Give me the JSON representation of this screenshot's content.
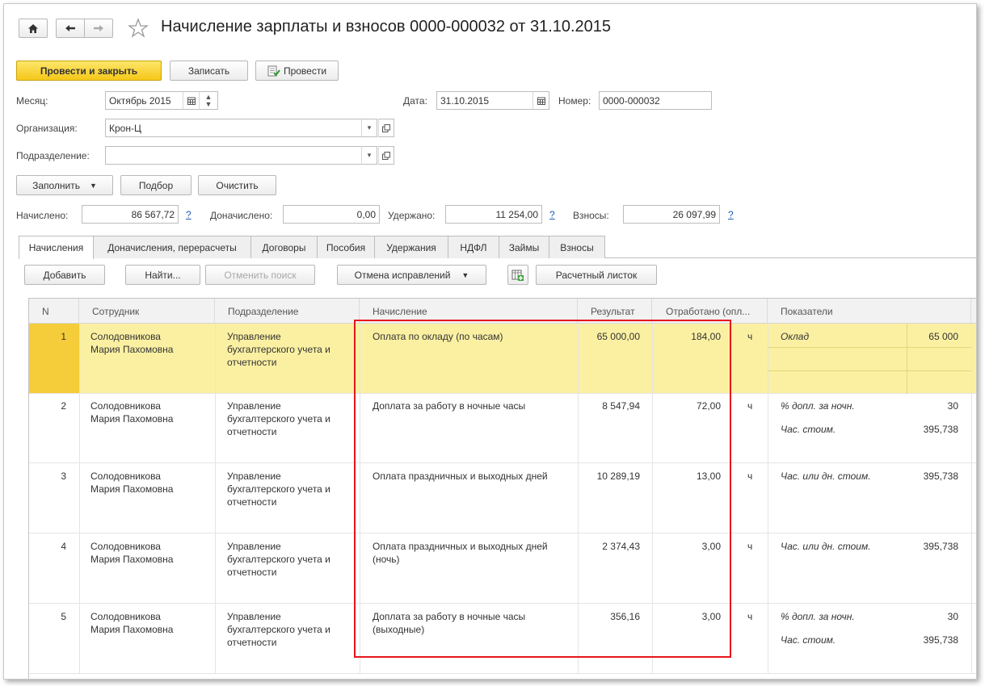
{
  "header": {
    "title": "Начисление зарплаты и взносов 0000-000032 от 31.10.2015",
    "home_icon": "home-icon",
    "back_icon": "arrow-left-icon",
    "forward_icon": "arrow-right-icon",
    "star_icon": "star-icon"
  },
  "toolbar": {
    "post_close_label": "Провести и закрыть",
    "save_label": "Записать",
    "post_label": "Провести"
  },
  "form": {
    "month_label": "Месяц:",
    "month_value": "Октябрь 2015",
    "date_label": "Дата:",
    "date_value": "31.10.2015",
    "number_label": "Номер:",
    "number_value": "0000-000032",
    "org_label": "Организация:",
    "org_value": "Крон-Ц",
    "dept_label": "Подразделение:",
    "dept_value": ""
  },
  "actions": {
    "fill_label": "Заполнить",
    "select_label": "Подбор",
    "clear_label": "Очистить"
  },
  "totals": {
    "accrued_label": "Начислено:",
    "accrued_value": "86 567,72",
    "additional_label": "Доначислено:",
    "additional_value": "0,00",
    "withheld_label": "Удержано:",
    "withheld_value": "11 254,00",
    "contrib_label": "Взносы:",
    "contrib_value": "26 097,99",
    "help_mark": "?"
  },
  "tabs": [
    {
      "label": "Начисления"
    },
    {
      "label": "Доначисления, перерасчеты"
    },
    {
      "label": "Договоры"
    },
    {
      "label": "Пособия"
    },
    {
      "label": "Удержания"
    },
    {
      "label": "НДФЛ"
    },
    {
      "label": "Займы"
    },
    {
      "label": "Взносы"
    }
  ],
  "table_toolbar": {
    "add_label": "Добавить",
    "find_label": "Найти...",
    "cancel_search_label": "Отменить поиск",
    "cancel_fix_label": "Отмена исправлений",
    "payslip_label": "Расчетный листок"
  },
  "columns": [
    "N",
    "Сотрудник",
    "Подразделение",
    "Начисление",
    "Результат",
    "Отработано (опл...",
    "Показатели"
  ],
  "rows": [
    {
      "n": "1",
      "emp1": "Солодовникова",
      "emp2": "Мария Пахомовна",
      "dept1": "Управление",
      "dept2": "бухгалтерского учета и",
      "dept3": "отчетности",
      "acc1": "Оплата по окладу (по часам)",
      "acc2": "",
      "result": "65 000,00",
      "worked": "184,00",
      "unit": "ч",
      "ind1_name": "Оклад",
      "ind1_val": "65 000",
      "ind2_name": "",
      "ind2_val": ""
    },
    {
      "n": "2",
      "emp1": "Солодовникова",
      "emp2": "Мария Пахомовна",
      "dept1": "Управление",
      "dept2": "бухгалтерского учета и",
      "dept3": "отчетности",
      "acc1": "Доплата за работу в ночные часы",
      "acc2": "",
      "result": "8 547,94",
      "worked": "72,00",
      "unit": "ч",
      "ind1_name": "% допл. за ночн.",
      "ind1_val": "30",
      "ind2_name": "Час. стоим.",
      "ind2_val": "395,738"
    },
    {
      "n": "3",
      "emp1": "Солодовникова",
      "emp2": "Мария Пахомовна",
      "dept1": "Управление",
      "dept2": "бухгалтерского учета и",
      "dept3": "отчетности",
      "acc1": "Оплата праздничных и выходных дней",
      "acc2": "",
      "result": "10 289,19",
      "worked": "13,00",
      "unit": "ч",
      "ind1_name": "Час. или дн. стоим.",
      "ind1_val": "395,738",
      "ind2_name": "",
      "ind2_val": ""
    },
    {
      "n": "4",
      "emp1": "Солодовникова",
      "emp2": "Мария Пахомовна",
      "dept1": "Управление",
      "dept2": "бухгалтерского учета и",
      "dept3": "отчетности",
      "acc1": "Оплата праздничных и выходных дней",
      "acc2": "(ночь)",
      "result": "2 374,43",
      "worked": "3,00",
      "unit": "ч",
      "ind1_name": "Час. или дн. стоим.",
      "ind1_val": "395,738",
      "ind2_name": "",
      "ind2_val": ""
    },
    {
      "n": "5",
      "emp1": "Солодовникова",
      "emp2": "Мария Пахомовна",
      "dept1": "Управление",
      "dept2": "бухгалтерского учета и",
      "dept3": "отчетности",
      "acc1": "Доплата за работу в ночные часы",
      "acc2": "(выходные)",
      "result": "356,16",
      "worked": "3,00",
      "unit": "ч",
      "ind1_name": "% допл. за ночн.",
      "ind1_val": "30",
      "ind2_name": "Час. стоим.",
      "ind2_val": "395,738"
    }
  ],
  "colors": {
    "primary_button": "#f5c718",
    "selected_row": "#fbf0a2",
    "selected_number_cell": "#f5cd3a",
    "highlight_box": "#e8141c"
  }
}
